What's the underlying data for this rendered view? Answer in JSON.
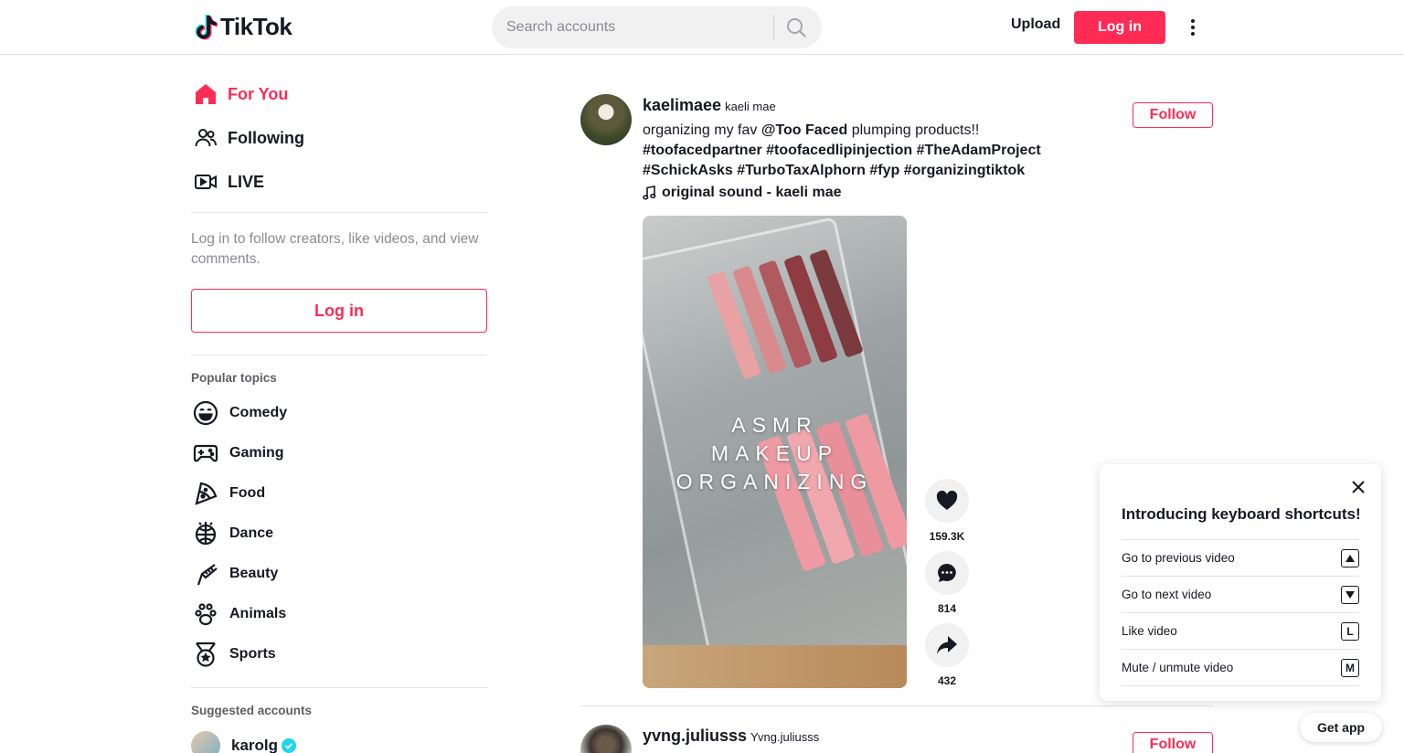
{
  "header": {
    "logo_text": "TikTok",
    "search_placeholder": "Search accounts",
    "upload_label": "Upload",
    "login_label": "Log in"
  },
  "sidebar": {
    "nav": [
      {
        "label": "For You",
        "icon": "home-icon",
        "active": true
      },
      {
        "label": "Following",
        "icon": "people-icon",
        "active": false
      },
      {
        "label": "LIVE",
        "icon": "live-icon",
        "active": false
      }
    ],
    "login_hint": "Log in to follow creators, like videos, and view comments.",
    "login_label": "Log in",
    "popular_topics_title": "Popular topics",
    "topics": [
      {
        "label": "Comedy",
        "icon": "comedy-icon"
      },
      {
        "label": "Gaming",
        "icon": "gaming-icon"
      },
      {
        "label": "Food",
        "icon": "food-icon"
      },
      {
        "label": "Dance",
        "icon": "dance-icon"
      },
      {
        "label": "Beauty",
        "icon": "beauty-icon"
      },
      {
        "label": "Animals",
        "icon": "animals-icon"
      },
      {
        "label": "Sports",
        "icon": "sports-icon"
      }
    ],
    "suggested_title": "Suggested accounts",
    "accounts": [
      {
        "name": "karolg",
        "verified": true
      }
    ]
  },
  "feed": {
    "posts": [
      {
        "username": "kaelimaee",
        "nickname": "kaeli mae",
        "caption_parts": [
          "organizing my fav ",
          "@Too Faced",
          " plumping products!! ",
          "#toofacedpartner",
          " ",
          "#toofacedlipinjection",
          " ",
          "#TheAdamProject",
          " ",
          "#SchickAsks",
          " ",
          "#TurboTaxAlphorn",
          " ",
          "#fyp",
          " ",
          "#organizingtiktok"
        ],
        "music": "original sound - kaeli mae",
        "follow_label": "Follow",
        "video_overlay": [
          "ASMR",
          "MAKEUP",
          "ORGANIZING"
        ],
        "likes": "159.3K",
        "comments": "814",
        "shares": "432"
      },
      {
        "username": "yvng.juliusss",
        "nickname": "Yvng.juliusss",
        "follow_label": "Follow"
      }
    ]
  },
  "keyboard_panel": {
    "title": "Introducing keyboard shortcuts!",
    "rows": [
      {
        "label": "Go to previous video",
        "key": "▲"
      },
      {
        "label": "Go to next video",
        "key": "▼"
      },
      {
        "label": "Like video",
        "key": "L"
      },
      {
        "label": "Mute / unmute video",
        "key": "M"
      }
    ]
  },
  "get_app_label": "Get app",
  "colors": {
    "brand": "#fe2c55",
    "text": "#161823",
    "muted": "#8a8b91",
    "verified": "#20d5ec"
  }
}
